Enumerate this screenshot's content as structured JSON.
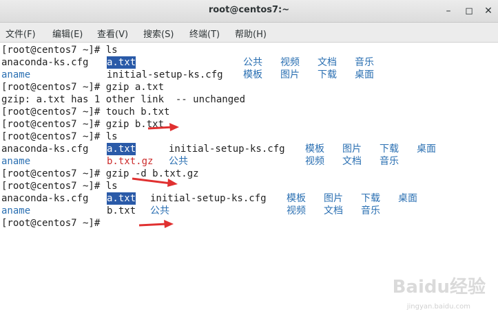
{
  "window": {
    "title": "root@centos7:~",
    "minimize_glyph": "–",
    "maximize_glyph": "◻",
    "close_glyph": "✕"
  },
  "menu": [
    "文件(F)",
    "编辑(E)",
    "查看(V)",
    "搜索(S)",
    "终端(T)",
    "帮助(H)"
  ],
  "terminal": {
    "lines": [
      "[root@centos7 ~]# ls",
      "",
      "",
      "[root@centos7 ~]# gzip a.txt",
      "gzip: a.txt has 1 other link  -- unchanged",
      "[root@centos7 ~]# touch b.txt",
      "[root@centos7 ~]# gzip b.txt",
      "[root@centos7 ~]# ls",
      "",
      "",
      "[root@centos7 ~]# gzip -d b.txt.gz",
      "[root@centos7 ~]# ls",
      "",
      "",
      "[root@centos7 ~]#"
    ],
    "ls1": {
      "row1": [
        "anaconda-ks.cfg",
        "a.txt",
        "公共",
        "视频",
        "文档",
        "音乐"
      ],
      "row2": [
        "aname",
        "initial-setup-ks.cfg",
        "模板",
        "图片",
        "下载",
        "桌面"
      ]
    },
    "ls2": {
      "row1": [
        "anaconda-ks.cfg",
        "a.txt",
        "initial-setup-ks.cfg",
        "模板",
        "图片",
        "下载",
        "桌面"
      ],
      "row2": [
        "aname",
        "b.txt.gz",
        "公共",
        "视频",
        "文档",
        "音乐"
      ]
    },
    "ls3": {
      "row1": [
        "anaconda-ks.cfg",
        "a.txt",
        "initial-setup-ks.cfg",
        "模板",
        "图片",
        "下载",
        "桌面"
      ],
      "row2": [
        "aname",
        "b.txt",
        "公共",
        "视频",
        "文档",
        "音乐"
      ]
    },
    "colors": {
      "directory": "#2a6fb2",
      "archive": "#cc2b2b",
      "selection": "#2a5aa8",
      "annotation_arrow": "#e03030"
    }
  },
  "watermark": {
    "brand": "Baidu经验",
    "url": "jingyan.baidu.com"
  }
}
